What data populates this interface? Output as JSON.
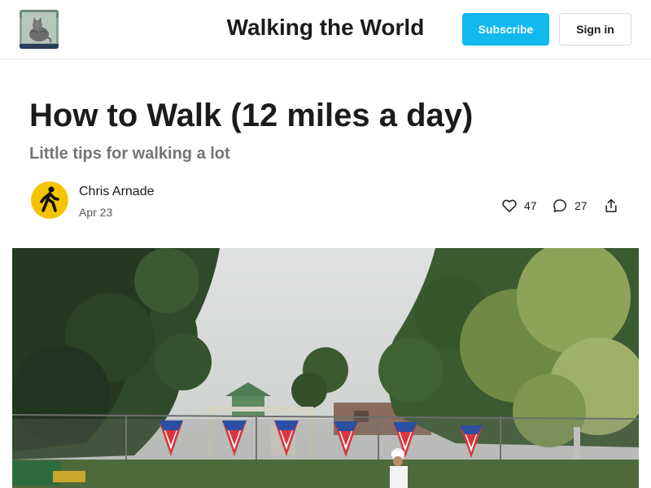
{
  "header": {
    "site_title": "Walking the World",
    "subscribe_label": "Subscribe",
    "signin_label": "Sign in"
  },
  "post": {
    "title": "How to Walk (12 miles a day)",
    "subtitle": "Little tips for walking a lot",
    "author": "Chris Arnade",
    "date": "Apr 23",
    "likes": "47",
    "comments": "27"
  },
  "icons": {
    "logo": "cat-photo-logo",
    "avatar": "pedestrian-sign-avatar",
    "like": "heart-icon",
    "comment": "comment-bubble-icon",
    "share": "share-icon"
  },
  "colors": {
    "accent": "#12b9ef",
    "text": "#1b1b1b",
    "muted": "#757575",
    "avatar_bg": "#f5c400"
  }
}
